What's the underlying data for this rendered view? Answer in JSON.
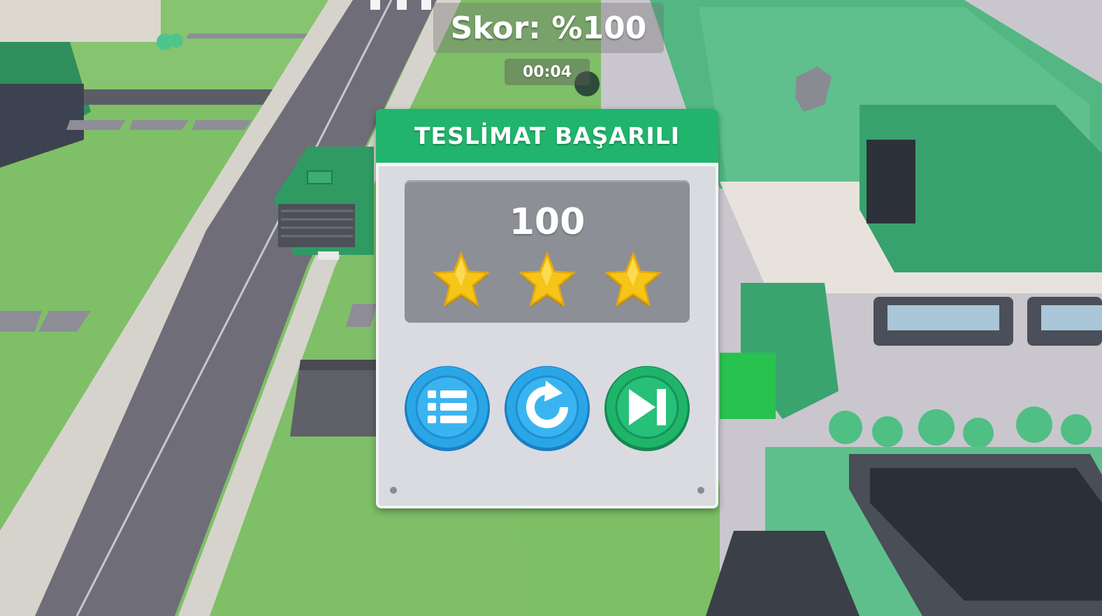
{
  "hud": {
    "score_text": "Skor: %100",
    "timer_text": "00:04"
  },
  "dialog": {
    "title": "TESLİMAT BAŞARILI",
    "score": "100",
    "stars_earned": 3,
    "stars_total": 3,
    "buttons": [
      {
        "icon": "list-icon",
        "color": "#2aa6e6"
      },
      {
        "icon": "restart-icon",
        "color": "#2aa6e6"
      },
      {
        "icon": "next-level-icon",
        "color": "#20b46a"
      }
    ]
  },
  "colors": {
    "header_green": "#21b46c",
    "panel_gray": "#8d8f96",
    "star_gold": "#f5c518"
  }
}
